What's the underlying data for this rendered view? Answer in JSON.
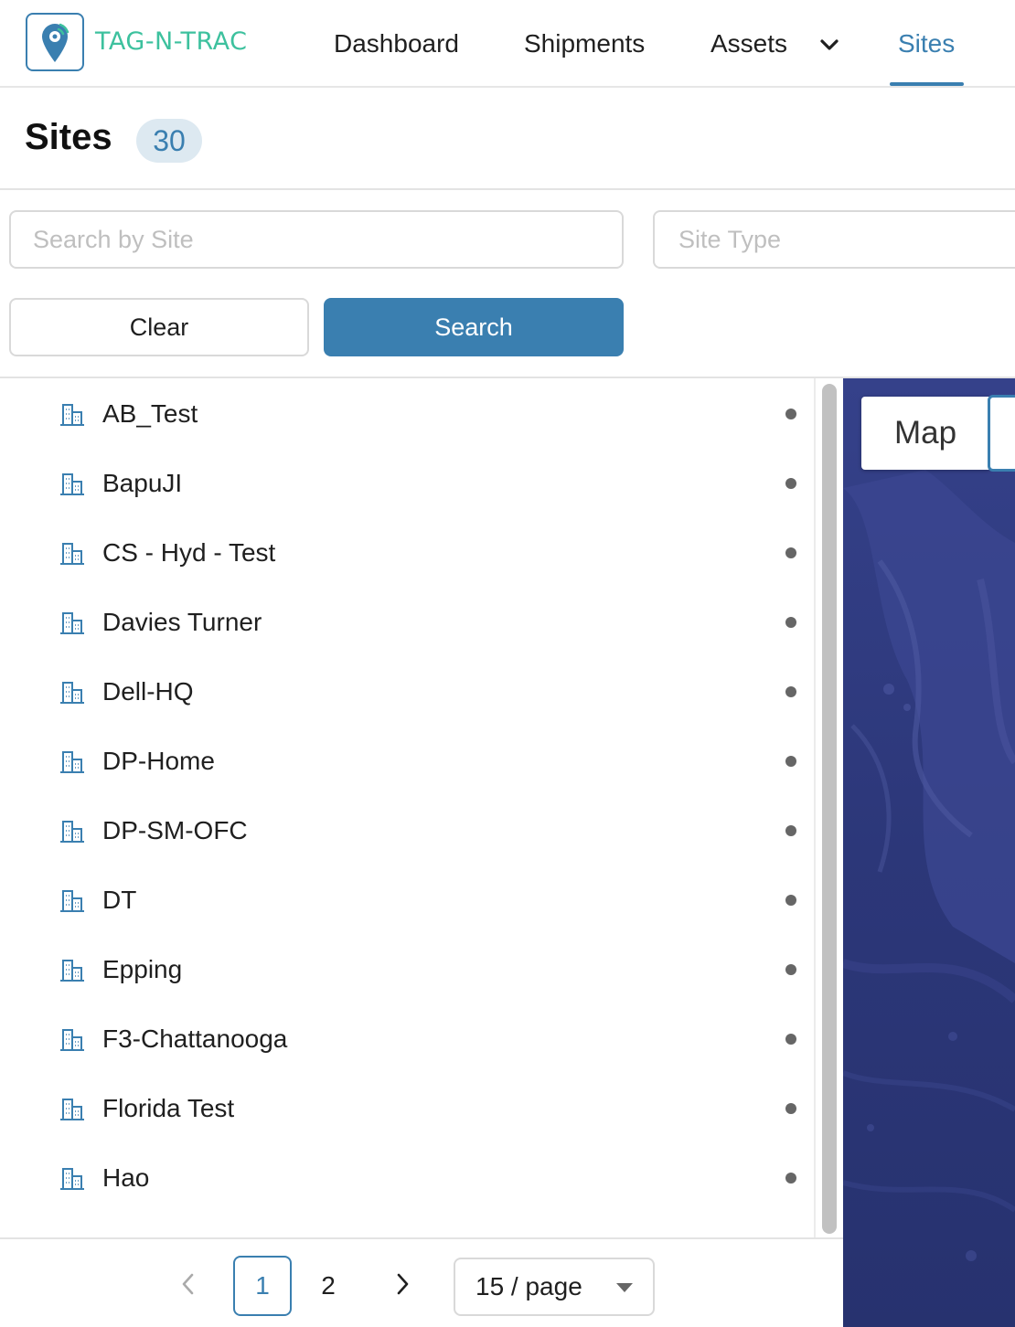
{
  "header": {
    "logo_text": "TAG-N-TRAC",
    "nav": [
      {
        "label": "Dashboard"
      },
      {
        "label": "Shipments"
      },
      {
        "label": "Assets"
      },
      {
        "label": "Sites"
      }
    ],
    "active_nav": "Sites"
  },
  "page": {
    "title": "Sites",
    "count": "30"
  },
  "filters": {
    "search_placeholder": "Search by Site",
    "search_value": "",
    "site_type_placeholder": "Site Type",
    "clear_label": "Clear",
    "search_label": "Search"
  },
  "sites": [
    {
      "name": "AB_Test"
    },
    {
      "name": "BapuJI"
    },
    {
      "name": "CS - Hyd - Test"
    },
    {
      "name": "Davies Turner"
    },
    {
      "name": "Dell-HQ"
    },
    {
      "name": "DP-Home"
    },
    {
      "name": "DP-SM-OFC"
    },
    {
      "name": "DT"
    },
    {
      "name": "Epping"
    },
    {
      "name": "F3-Chattanooga"
    },
    {
      "name": "Florida Test"
    },
    {
      "name": "Hao"
    }
  ],
  "pagination": {
    "pages": [
      "1",
      "2"
    ],
    "current_page": "1",
    "page_size": "15 / page"
  },
  "map": {
    "tab_label": "Map"
  },
  "colors": {
    "accent": "#3a7fb0",
    "logo_green": "#3dc19e",
    "map_ocean": "#2f3a7e"
  }
}
